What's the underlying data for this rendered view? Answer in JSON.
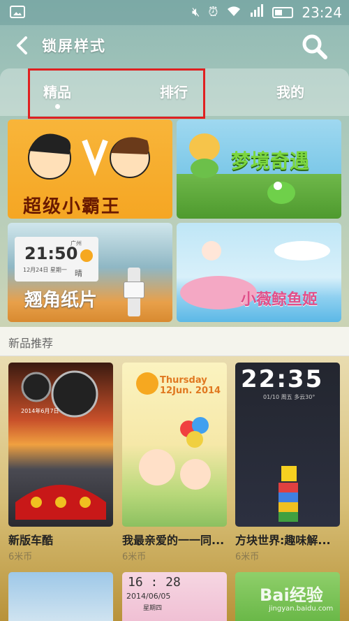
{
  "status_bar": {
    "time": "23:24"
  },
  "header": {
    "title": "锁屏样式"
  },
  "tabs": [
    {
      "label": "精品"
    },
    {
      "label": "排行"
    },
    {
      "label": "我的"
    }
  ],
  "banners": [
    {
      "label": "超级小霸王"
    },
    {
      "label": "梦境奇遇"
    },
    {
      "label": "翘角纸片",
      "clock": "21:50",
      "date": "12月24日 星期一",
      "city": "广州",
      "weather": "晴"
    },
    {
      "label": "小薇鲸鱼姬"
    }
  ],
  "section": {
    "title": "新品推荐"
  },
  "cards": [
    {
      "name": "新版车酷",
      "price": "6米币",
      "art_text": "2014年6月7日"
    },
    {
      "name": "我最亲爱的一一同...",
      "price": "6米币",
      "art_text": "Thursday 12Jun. 2014"
    },
    {
      "name": "方块世界:趣味解...",
      "price": "6米币",
      "art_text": "22:35",
      "art_sub": "01/10 周五 多云30°"
    }
  ],
  "bottom_cards": [
    {
      "art_text": ""
    },
    {
      "art_text": "16 : 28",
      "art_sub": "2014/06/05",
      "art_sub2": "星期四"
    },
    {
      "art_text": ""
    }
  ],
  "watermark": {
    "text": "Bai经验",
    "sub": "jingyan.baidu.com"
  }
}
